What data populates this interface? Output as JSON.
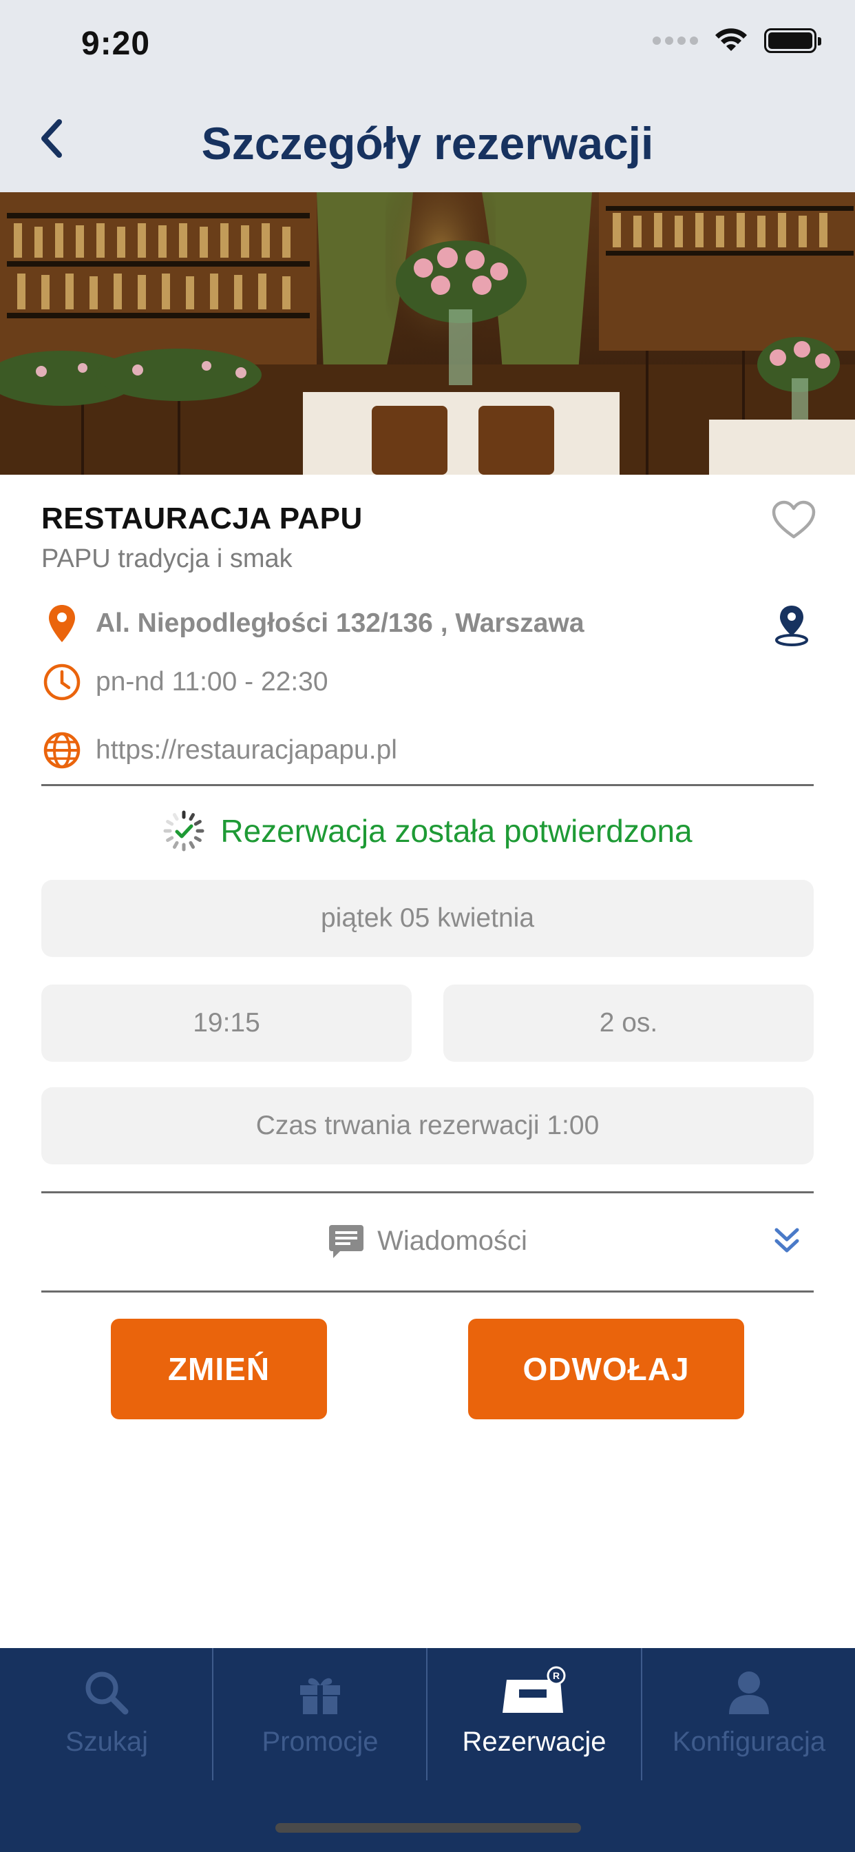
{
  "status_bar": {
    "time": "9:20"
  },
  "header": {
    "title": "Szczegóły rezerwacji",
    "back_icon": "chevron-left-icon"
  },
  "restaurant": {
    "name": "RESTAURACJA PAPU",
    "tagline": "PAPU tradycja i smak",
    "address": "Al. Niepodległości  132/136 , Warszawa",
    "hours": "pn-nd  11:00 - 22:30",
    "website": "https://restauracjapapu.pl"
  },
  "reservation": {
    "status": "Rezerwacja została potwierdzona",
    "date": "piątek 05 kwietnia",
    "time": "19:15",
    "guests": "2 os.",
    "duration": "Czas trwania rezerwacji 1:00"
  },
  "messages": {
    "label": "Wiadomości"
  },
  "actions": {
    "change": "ZMIEŃ",
    "cancel": "ODWOŁAJ"
  },
  "nav": {
    "items": [
      {
        "label": "Szukaj",
        "icon": "search-icon"
      },
      {
        "label": "Promocje",
        "icon": "gift-icon"
      },
      {
        "label": "Rezerwacje",
        "icon": "reservation-icon",
        "active": true
      },
      {
        "label": "Konfiguracja",
        "icon": "user-icon"
      }
    ]
  },
  "colors": {
    "primary": "#17325f",
    "accent": "#ea640c",
    "success": "#1e9a35",
    "muted": "#8a8a8a",
    "pill_bg": "#f2f2f2"
  }
}
